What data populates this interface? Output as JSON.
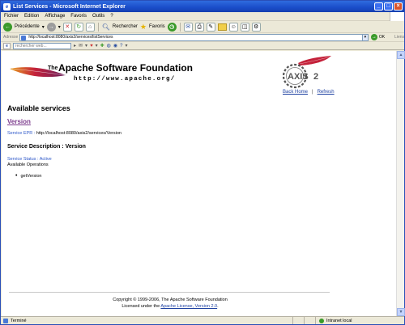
{
  "window": {
    "title": "List Services - Microsoft Internet Explorer"
  },
  "menu": [
    "Fichier",
    "Edition",
    "Affichage",
    "Favoris",
    "Outils",
    "?"
  ],
  "toolbar": {
    "back_label": "Précédente",
    "search_label": "Rechercher",
    "favorites_label": "Favoris"
  },
  "address": {
    "label": "Adresse",
    "url": "http://localhost:8080/axis2/services/listServices",
    "go_label": "OK",
    "links_label": "Liens"
  },
  "searchbar": {
    "placeholder": "rechercher web..."
  },
  "header": {
    "apache_the": "The",
    "apache_name": "Apache Software Foundation",
    "apache_url": "http://www.apache.org/",
    "back_home": "Back Home",
    "separator": "|",
    "refresh": "Refresh"
  },
  "services": {
    "heading": "Available services",
    "service_name": "Version",
    "epr_label": "Service EPR :",
    "epr_value": "http://localhost:8080/axis2/services/Version",
    "description_heading": "Service Description : Version",
    "status": "Service Status : Active",
    "operations_heading": "Available Operations",
    "operations": [
      "getVersion"
    ]
  },
  "footer": {
    "copyright": "Copyright © 1999-2006, The Apache Software Foundation",
    "license_prefix": "Licensed under the",
    "license_link": "Apache License, Version 2.0",
    "license_suffix": "."
  },
  "statusbar": {
    "state": "Terminé",
    "zone": "Intranet local"
  },
  "colors": {
    "titlebar": "#1a4cc9",
    "link": "#1c3fa0",
    "visited": "#7b3a8c",
    "feather": "#c4213a"
  }
}
